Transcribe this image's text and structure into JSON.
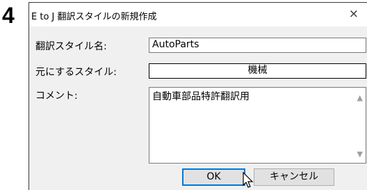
{
  "step_number": "4",
  "dialog": {
    "title": "E to J 翻訳スタイルの新規作成",
    "close_label": "×",
    "style_name_label": "翻訳スタイル名:",
    "style_name_value": "AutoParts",
    "base_style_label": "元にするスタイル:",
    "base_style_value": "機械",
    "comment_label": "コメント:",
    "comment_value": "自動車部品特許翻訳用",
    "ok_label": "OK",
    "cancel_label": "キャンセル"
  },
  "icons": {
    "close": "close-icon",
    "scroll_up": "scroll-up-icon",
    "scroll_down": "scroll-down-icon",
    "cursor": "mouse-pointer-icon"
  }
}
